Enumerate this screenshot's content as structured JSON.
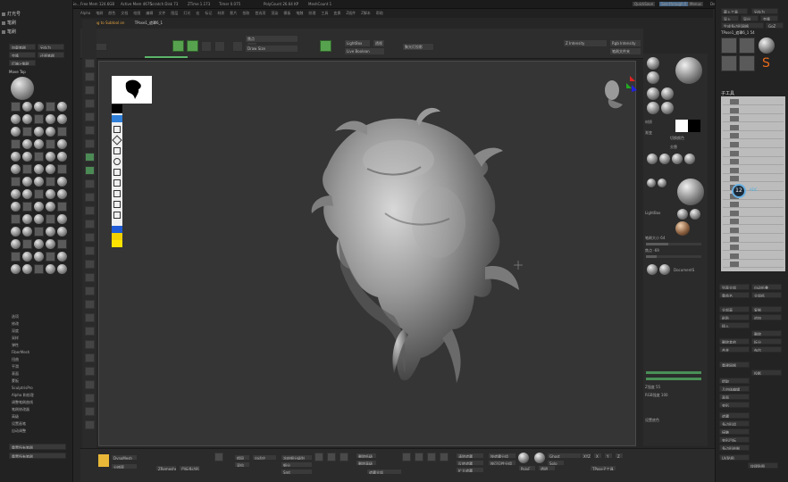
{
  "titlebar": {
    "app_title": "ZBrush 2020",
    "doc": "ZbrushSplinesSpline_Se...",
    "mem1": "Free Mem 124.6GB",
    "mem2": "Active Mem 4675",
    "mem3": "Scratch Disk 73",
    "mem4": "ZTime 1.173",
    "mem5": "Timer 0.075",
    "poly": "PolyCount 26.64 KP",
    "mesh": "MeshCount 1",
    "quicksave": "QuickSave",
    "seethrough": "See-through 0",
    "menus": "Menus",
    "default_script": "DefaultZScript"
  },
  "menubar": [
    "Alpha",
    "笔刷",
    "颜色",
    "文档",
    "绘图",
    "编辑",
    "文件",
    "图层",
    "灯光",
    "宏",
    "标记",
    "材质",
    "影片",
    "拾取",
    "首选项",
    "渲染",
    "模板",
    "笔触",
    "纹理",
    "工具",
    "变换",
    "Z插件",
    "Z脚本",
    "帮助"
  ],
  "status": {
    "switching": "Switching to Subtool on",
    "subtool": "TPose1_遮罩6_1"
  },
  "left": {
    "header1": "灯光号",
    "header2": "笔刷",
    "header3": "笔刷",
    "btn_load": "加载笔刷",
    "btn_saveas": "另存为",
    "btn_clone": "克隆",
    "btn_default": "还原笔刷",
    "btn_lightbox": "灯箱>笔刷",
    "brush_name": "Move Top",
    "menu_items": [
      "选项",
      "修改",
      "深度",
      "采样",
      "弹性",
      "FiberMesh",
      "扭曲",
      "平滑",
      "表面",
      "蒙板",
      "SculptrisPro",
      "Alpha 和纹理",
      "调整笔刷曲线",
      "笔刷修改器",
      "高级",
      "设置画笔",
      "自动调整"
    ],
    "btn_reset_all": "重置所有笔刷",
    "btn_reset_current": "重置所有笔刷"
  },
  "shelf": {
    "edit": "打开",
    "draw": "Draw",
    "move": "Move",
    "scale": "Scale",
    "rotate": "Rotate",
    "mrgb": "Mrgb",
    "rgb": "Rgb",
    "m": "M",
    "zadd": "Zadd",
    "zsub": "Zsub",
    "zcut": "Zcut",
    "focal": "焦点",
    "draw_size": "Draw Size",
    "dynamic": "Dynamic",
    "zintensity": "Z Intensity",
    "rgb_intensity": "Rgb Intensity",
    "lightbox": "LightBox",
    "live_boolean": "Live Boolean",
    "spotlight": "聚光灯投影",
    "persp": "透视",
    "floor": "地面",
    "gizmo": "Gizmo",
    "tpose": "TPose>SubT",
    "brush_replace": "笔刷文件夹"
  },
  "right_mat": {
    "mat_label": "材质",
    "gradient": "渐变",
    "switch_color": "切换颜色",
    "alternate": "交替",
    "intensity": "强度 4",
    "lightbox": "LightBox",
    "matcap": "MatCap",
    "texture": "纹理",
    "bpr": "BPR",
    "doc_colorize": "DocumentS",
    "defaults_a": "设置底色",
    "size_label": "笔刷大小 64",
    "focal_label": "焦点 -69",
    "z_label": "Z强度 55",
    "rgb_label": "RGB强度 100"
  },
  "right": {
    "tool_header": "工具",
    "load_tool": "载入工具",
    "save_as": "另存为",
    "import": "导入",
    "export": "导出",
    "clone": "克隆",
    "make_polymesh": "生成多边形网格",
    "goz": "GoZ",
    "all": "全部",
    "visible": "可见",
    "tpose_name": "TPose1_遮罩6_1 54",
    "subtool": "子工具",
    "list_all": "列表全部",
    "auto_collapse": "自动折叠",
    "rename": "重命名",
    "all_low": "全部低",
    "all_high": "全部高",
    "copy": "复制",
    "paste": "粘贴",
    "append": "追加",
    "insert": "插入",
    "delete": "删除",
    "del_other": "删除其他",
    "split": "拆分",
    "merge": "合并",
    "boolean": "布尔",
    "remesh": "重建网格",
    "project": "投影",
    "extract": "提取",
    "geometry": "几何体编辑",
    "surface": "表面",
    "deformation": "变形",
    "masking": "遮罩",
    "polygroups": "多边形组",
    "contact": "接触",
    "morph": "变形目标",
    "polypaint": "多边形绘制",
    "uv_map": "UV贴图",
    "texture_map": "纹理贴图",
    "displacement": "置换贴图",
    "normal_map": "法线贴图",
    "vector_disp": "矢量置换贴图",
    "display_props": "显示属性",
    "unified_skin": "统一蒙皮",
    "initialize": "初始化",
    "import2": "导入",
    "export2": "导出",
    "count": "12",
    "num_label": "ADC"
  },
  "bottom": {
    "dynamesh": "DynaMesh",
    "resolution": "分辨率",
    "zremesher": "ZRemesher",
    "target": "目标多边形数",
    "half": "一半",
    "same": "相同",
    "double": "双倍",
    "adapt": "自适应",
    "freeze": "冻结细分级别",
    "divide": "细分",
    "smt": "Smt",
    "del_lower": "删除低级",
    "del_higher": "删除高级",
    "mask_all": "遮罩全部",
    "clear_mask": "清除遮罩",
    "invert": "反转遮罩",
    "grow": "扩大遮罩",
    "shrink": "收缩遮罩",
    "sharpen": "锐化遮罩",
    "blur": "模糊遮罩",
    "group_vis": "按可见性分组",
    "group_mask": "按遮罩分组",
    "polyf": "PolyF",
    "tpose_sub": "TPose子工具",
    "transp": "透明",
    "ghost": "Ghost",
    "solo": "Solo",
    "xyz": "XYZ",
    "sym_x": "X",
    "sym_y": "Y",
    "sym_z": "Z"
  }
}
